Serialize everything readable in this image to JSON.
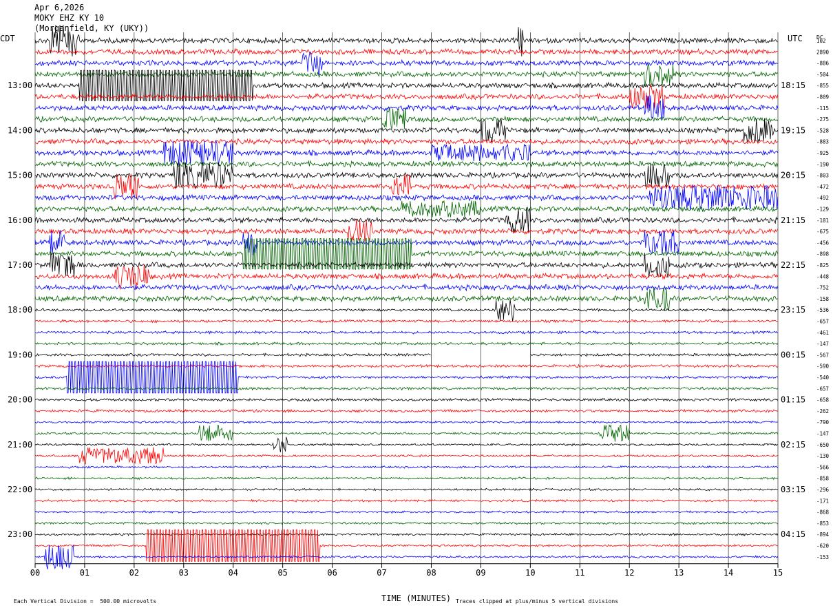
{
  "header": {
    "date": "Apr 6,2026",
    "station": "MOKY EHZ KY 10",
    "location": "(Morganfield, KY (UKY))"
  },
  "axis": {
    "left_label": "CDT",
    "right_label": "UTC",
    "dc_label": "DC",
    "xlabel": "TIME (MINUTES)",
    "scale_note": "Each Vertical Division =  500.00 microvolts",
    "clip_note": "Traces clipped at plus/minus 5 vertical divisions"
  },
  "colors": {
    "black": "#000000",
    "red": "#ff0000",
    "blue": "#0000ff",
    "green": "#006400",
    "grid": "#000000"
  },
  "chart_data": {
    "type": "line",
    "title": "",
    "xlabel": "TIME (MINUTES)",
    "ylabel": "",
    "xlim": [
      0,
      15
    ],
    "x_ticks": [
      "00",
      "01",
      "02",
      "03",
      "04",
      "05",
      "06",
      "07",
      "08",
      "09",
      "10",
      "11",
      "12",
      "13",
      "14",
      "15"
    ],
    "trace_color_cycle": [
      "black",
      "red",
      "blue",
      "green"
    ],
    "traces_per_hour": 4,
    "left_hour_labels": [
      "13:00",
      "14:00",
      "15:00",
      "16:00",
      "17:00",
      "18:00",
      "19:00",
      "20:00",
      "21:00",
      "22:00",
      "23:00"
    ],
    "right_hour_labels": [
      "18:15",
      "19:15",
      "20:15",
      "21:15",
      "22:15",
      "23:15",
      "00:15",
      "01:15",
      "02:15",
      "03:15",
      "04:15"
    ],
    "dc_offsets": [
      "102",
      "2890",
      "-886",
      "-504",
      "-855",
      "-809",
      "-115",
      "-275",
      "-528",
      "-883",
      "-925",
      "-190",
      "-803",
      "-472",
      "-492",
      "-129",
      "-181",
      "-675",
      "-456",
      "-898",
      "-825",
      "-448",
      "-752",
      "-158",
      "-536",
      "-657",
      "-461",
      "-147",
      "-567",
      "-590",
      "-540",
      "-657",
      "-658",
      "-262",
      "-790",
      "-147",
      "-650",
      "-130",
      "-566",
      "-858",
      "-296",
      "-171",
      "-868",
      "-853",
      "-894",
      "-620",
      "-153"
    ],
    "events": [
      {
        "trace": 0,
        "start": 0.3,
        "end": 0.9,
        "amp": 4,
        "color": "red"
      },
      {
        "trace": 0,
        "start": 9.75,
        "end": 9.85,
        "amp": 5,
        "color": "black"
      },
      {
        "trace": 2,
        "start": 5.4,
        "end": 5.8,
        "amp": 3,
        "color": "blue"
      },
      {
        "trace": 3,
        "start": 12.3,
        "end": 12.9,
        "amp": 3,
        "color": "green"
      },
      {
        "trace": 4,
        "start": 0.9,
        "end": 4.4,
        "amp": 3,
        "color": "black",
        "style": "boxcar"
      },
      {
        "trace": 5,
        "start": 12.0,
        "end": 12.7,
        "amp": 3,
        "color": "red"
      },
      {
        "trace": 6,
        "start": 12.3,
        "end": 12.7,
        "amp": 3,
        "color": "blue"
      },
      {
        "trace": 7,
        "start": 7.0,
        "end": 7.5,
        "amp": 3,
        "color": "green"
      },
      {
        "trace": 8,
        "start": 9.0,
        "end": 9.5,
        "amp": 3,
        "color": "black"
      },
      {
        "trace": 8,
        "start": 14.3,
        "end": 14.9,
        "amp": 3,
        "color": "black"
      },
      {
        "trace": 10,
        "start": 2.6,
        "end": 4.0,
        "amp": 3,
        "color": "blue"
      },
      {
        "trace": 10,
        "start": 8.0,
        "end": 10.0,
        "amp": 2,
        "color": "blue"
      },
      {
        "trace": 12,
        "start": 2.8,
        "end": 4.0,
        "amp": 3,
        "color": "black"
      },
      {
        "trace": 12,
        "start": 12.3,
        "end": 12.8,
        "amp": 3,
        "color": "black"
      },
      {
        "trace": 13,
        "start": 1.6,
        "end": 2.1,
        "amp": 3,
        "color": "red"
      },
      {
        "trace": 13,
        "start": 7.2,
        "end": 7.6,
        "amp": 3,
        "color": "red"
      },
      {
        "trace": 14,
        "start": 12.4,
        "end": 15.0,
        "amp": 3,
        "color": "blue"
      },
      {
        "trace": 15,
        "start": 7.4,
        "end": 9.0,
        "amp": 2,
        "color": "green"
      },
      {
        "trace": 16,
        "start": 9.5,
        "end": 10.0,
        "amp": 3,
        "color": "black"
      },
      {
        "trace": 17,
        "start": 6.3,
        "end": 6.8,
        "amp": 3,
        "color": "red"
      },
      {
        "trace": 18,
        "start": 0.3,
        "end": 0.6,
        "amp": 3,
        "color": "blue"
      },
      {
        "trace": 18,
        "start": 4.2,
        "end": 4.5,
        "amp": 3,
        "color": "blue"
      },
      {
        "trace": 18,
        "start": 12.3,
        "end": 13.0,
        "amp": 3,
        "color": "blue"
      },
      {
        "trace": 19,
        "start": 4.2,
        "end": 7.6,
        "amp": 3,
        "color": "green",
        "style": "boxcar"
      },
      {
        "trace": 20,
        "start": 0.3,
        "end": 0.8,
        "amp": 3,
        "color": "black"
      },
      {
        "trace": 20,
        "start": 12.3,
        "end": 12.8,
        "amp": 3,
        "color": "black"
      },
      {
        "trace": 21,
        "start": 1.6,
        "end": 2.3,
        "amp": 3,
        "color": "red"
      },
      {
        "trace": 23,
        "start": 12.3,
        "end": 12.8,
        "amp": 3,
        "color": "green"
      },
      {
        "trace": 24,
        "start": 9.3,
        "end": 9.7,
        "amp": 3,
        "color": "black"
      },
      {
        "trace": 30,
        "start": 0.65,
        "end": 4.1,
        "amp": 4,
        "color": "blue",
        "style": "boxcar"
      },
      {
        "trace": 35,
        "start": 3.3,
        "end": 4.0,
        "amp": 2,
        "color": "green"
      },
      {
        "trace": 35,
        "start": 11.4,
        "end": 12.0,
        "amp": 2,
        "color": "green"
      },
      {
        "trace": 36,
        "start": 4.8,
        "end": 5.1,
        "amp": 2,
        "color": "black"
      },
      {
        "trace": 37,
        "start": 0.9,
        "end": 2.6,
        "amp": 2,
        "color": "red"
      },
      {
        "trace": 45,
        "start": 2.25,
        "end": 5.75,
        "amp": 4,
        "color": "red",
        "style": "boxcar"
      },
      {
        "trace": 46,
        "start": 0.2,
        "end": 0.8,
        "amp": 3,
        "color": "blue"
      }
    ],
    "data_gaps": [
      {
        "trace": 28,
        "start": 8.0,
        "end": 10.0
      }
    ]
  }
}
